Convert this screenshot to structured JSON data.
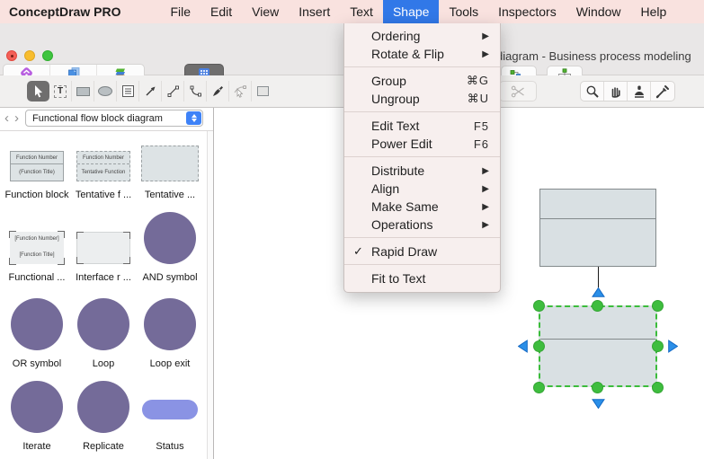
{
  "menubar": {
    "app_name": "ConceptDraw PRO",
    "items": [
      "File",
      "Edit",
      "View",
      "Insert",
      "Text",
      "Shape",
      "Tools",
      "Inspectors",
      "Window",
      "Help"
    ],
    "active_item": "Shape"
  },
  "shape_menu": {
    "items": [
      {
        "label": "Ordering",
        "right": "▶"
      },
      {
        "label": "Rotate & Flip",
        "right": "▶"
      },
      {
        "label": "Group",
        "right": "⌘G"
      },
      {
        "label": "Ungroup",
        "right": "⌘U"
      },
      {
        "label": "Edit Text",
        "right": "F5"
      },
      {
        "label": "Power Edit",
        "right": "F6"
      },
      {
        "label": "Distribute",
        "right": "▶"
      },
      {
        "label": "Align",
        "right": "▶"
      },
      {
        "label": "Make Same",
        "right": "▶"
      },
      {
        "label": "Operations",
        "right": "▶"
      },
      {
        "label": "Rapid Draw",
        "right": "",
        "check": "✓"
      },
      {
        "label": "Fit to Text",
        "right": ""
      }
    ]
  },
  "window": {
    "title_visible": "diagram - Business process modeling"
  },
  "toolbar_top": {
    "solutions_label": "Solutions",
    "pages_label": "Pages",
    "layers_label": "Layers",
    "library_label": "Library",
    "chain_label": "Chain",
    "tree_label": "Tree"
  },
  "tools": [
    "select",
    "text",
    "rectangle",
    "ellipse",
    "text-block",
    "arrow",
    "line",
    "arc",
    "pen",
    "reshape",
    "shape",
    "split",
    "zoom",
    "pan",
    "stamp",
    "eyedropper"
  ],
  "library_panel": {
    "selector_value": "Functional flow block diagram",
    "items": [
      {
        "label": "Function block",
        "line1": "Function Number",
        "line2": "(Function Title)"
      },
      {
        "label": "Tentative f ...",
        "line1": "Function Number",
        "line2": "Tentative Function"
      },
      {
        "label": "Tentative ..."
      },
      {
        "label": "Functional ...",
        "line1": "[Function Number]",
        "line2": "[Function Title]"
      },
      {
        "label": "Interface r ..."
      },
      {
        "label": "AND symbol"
      },
      {
        "label": "OR symbol"
      },
      {
        "label": "Loop"
      },
      {
        "label": "Loop exit"
      },
      {
        "label": "Iterate"
      },
      {
        "label": "Replicate"
      },
      {
        "label": "Status"
      }
    ]
  },
  "icons": {
    "back": "‹",
    "forward": "›",
    "text_tool": "T"
  },
  "colors": {
    "menubar_bg": "#f9e2df",
    "highlight_blue": "#3178e8",
    "purple_shape": "#746b99",
    "status_pill": "#8a93e4",
    "canvas_shape_fill": "#d9e0e3",
    "selection_green": "#3ebd3e",
    "arrow_blue": "#2b8fe8"
  }
}
